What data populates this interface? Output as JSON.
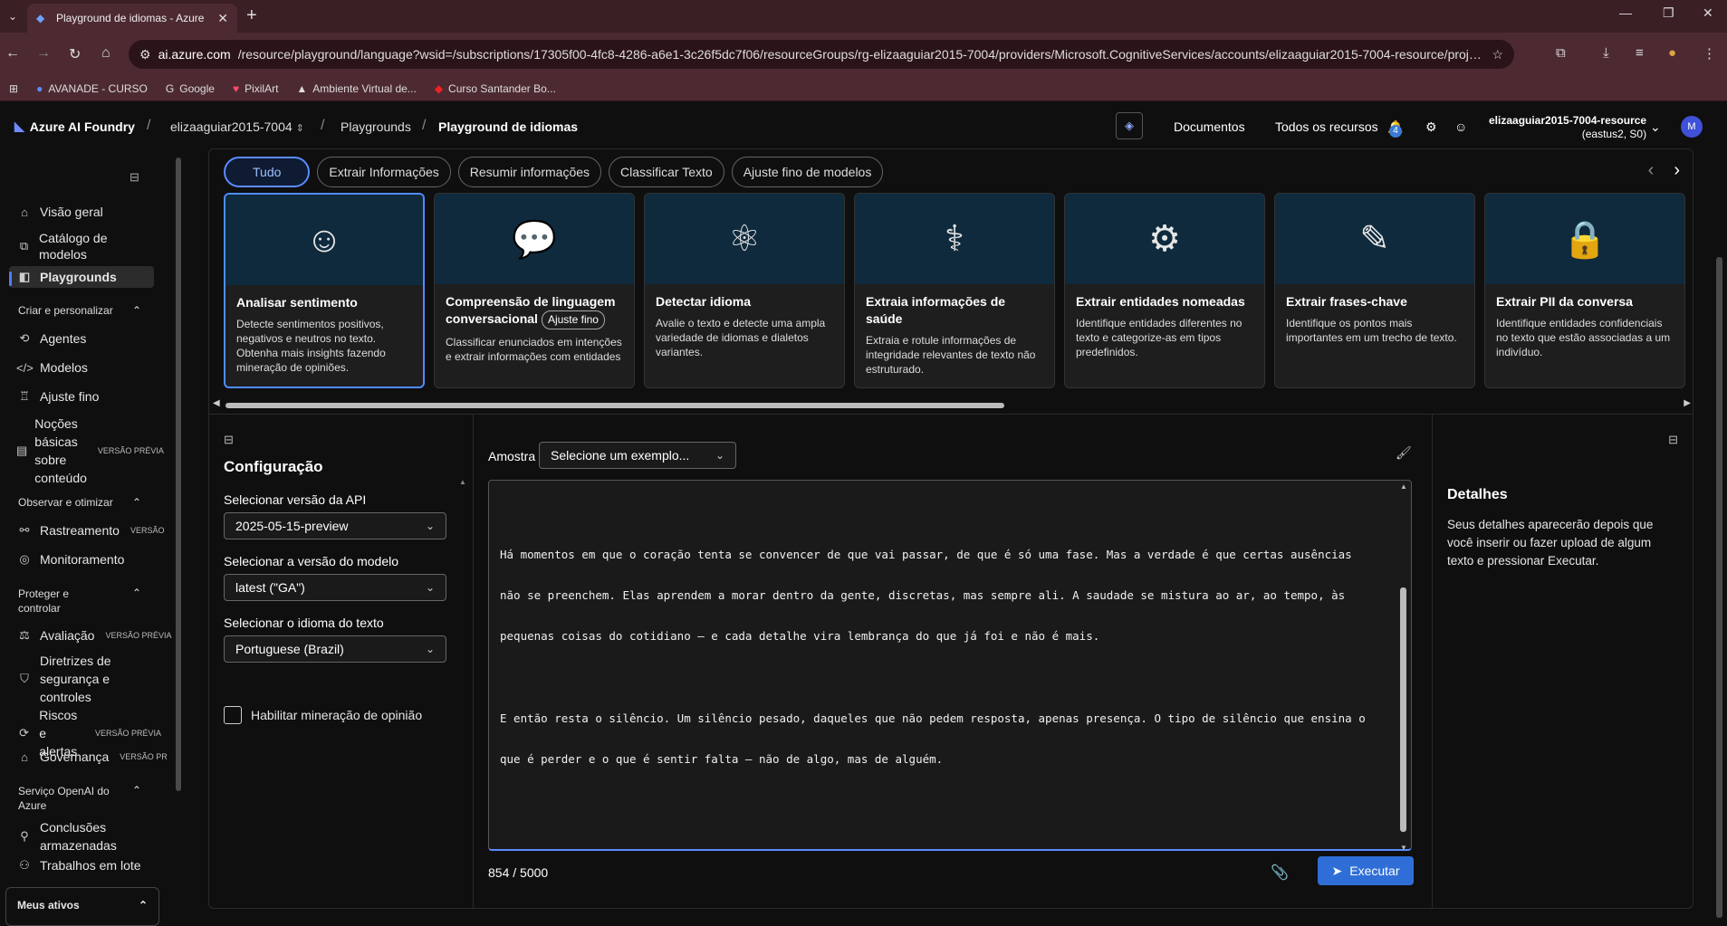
{
  "browser": {
    "tab_title": "Playground de idiomas - Azure",
    "url_host": "ai.azure.com",
    "url_rest": "/resource/playground/language?wsid=/subscriptions/17305f00-4fc8-4286-a6e1-3c26f5dc7f06/resourceGroups/rg-elizaaguiar2015-7004/providers/Microsoft.CognitiveServices/accounts/elizaaguiar2015-7004-resource/project...",
    "bookmarks": [
      "AVANADE - CURSO",
      "Google",
      "PixilArt",
      "Ambiente Virtual de...",
      "Curso Santander Bo..."
    ]
  },
  "header": {
    "brand": "Azure AI Foundry",
    "project": "elizaaguiar2015-7004",
    "crumb_playgrounds": "Playgrounds",
    "crumb_current": "Playground de idiomas",
    "docs": "Documentos",
    "all_resources": "Todos os recursos",
    "notif_count": "4",
    "account_name": "elizaaguiar2015-7004-resource",
    "account_region": "(eastus2, S0)",
    "avatar": "M"
  },
  "sidebar": {
    "items": {
      "overview": "Visão geral",
      "catalog": "Catálogo de modelos",
      "playgrounds": "Playgrounds",
      "section_create": "Criar e personalizar",
      "agents": "Agentes",
      "models": "Modelos",
      "finetune": "Ajuste fino",
      "content_basics": "Noções básicas sobre conteúdo",
      "section_observe": "Observar e otimizar",
      "tracing": "Rastreamento",
      "monitoring": "Monitoramento",
      "section_protect": "Proteger e controlar",
      "evaluation": "Avaliação",
      "guidelines": "Diretrizes de segurança e controles",
      "risks": "Riscos e alertas",
      "governance": "Governança",
      "section_openai": "Serviço OpenAI do Azure",
      "stored": "Conclusões armazenadas",
      "batch": "Trabalhos em lote",
      "my_assets": "Meus ativos"
    },
    "tags": {
      "preview": "VERSÃO PRÉVIA",
      "version": "VERSÃO",
      "preview_short": "VERSÃO PR"
    }
  },
  "filters": [
    "Tudo",
    "Extrair Informações",
    "Resumir informações",
    "Classificar Texto",
    "Ajuste fino de modelos"
  ],
  "cards": [
    {
      "title": "Analisar sentimento",
      "desc": "Detecte sentimentos positivos, negativos e neutros no texto. Obtenha mais insights fazendo mineração de opiniões."
    },
    {
      "title": "Compreensão de linguagem conversacional",
      "pill": "Ajuste fino",
      "desc": "Classificar enunciados em intenções e extrair informações com entidades"
    },
    {
      "title": "Detectar idioma",
      "desc": "Avalie o texto e detecte uma ampla variedade de idiomas e dialetos variantes."
    },
    {
      "title": "Extraia informações de saúde",
      "desc": "Extraia e rotule informações de integridade relevantes de texto não estruturado."
    },
    {
      "title": "Extrair entidades nomeadas",
      "desc": "Identifique entidades diferentes no texto e categorize-as em tipos predefinidos."
    },
    {
      "title": "Extrair frases-chave",
      "desc": "Identifique os pontos mais importantes em um trecho de texto."
    },
    {
      "title": "Extrair PII da conversa",
      "desc": "Identifique entidades confidenciais no texto que estão associadas a um indivíduo."
    }
  ],
  "config": {
    "title": "Configuração",
    "api_label": "Selecionar versão da API",
    "api_value": "2025-05-15-preview",
    "model_label": "Selecionar a versão do modelo",
    "model_value": "latest (\"GA\")",
    "lang_label": "Selecionar o idioma do texto",
    "lang_value": "Portuguese (Brazil)",
    "opinion_label": "Habilitar mineração de opinião"
  },
  "editor": {
    "sample_label": "Amostra",
    "sample_placeholder": "Selecione um exemplo...",
    "lines": [
      "Há momentos em que o coração tenta se convencer de que vai passar, de que é só uma fase. Mas a verdade é que certas ausências",
      "não se preenchem. Elas aprendem a morar dentro da gente, discretas, mas sempre ali. A saudade se mistura ao ar, ao tempo, às",
      "pequenas coisas do cotidiano — e cada detalhe vira lembrança do que já foi e não é mais.",
      "E então resta o silêncio. Um silêncio pesado, daqueles que não pedem resposta, apenas presença. O tipo de silêncio que ensina o",
      "que é perder e o que é sentir falta — não de algo, mas de alguém."
    ],
    "char_count": "854 / 5000",
    "run_label": "Executar"
  },
  "details": {
    "title": "Detalhes",
    "text": "Seus detalhes aparecerão depois que você inserir ou fazer upload de algum texto e pressionar Executar."
  }
}
